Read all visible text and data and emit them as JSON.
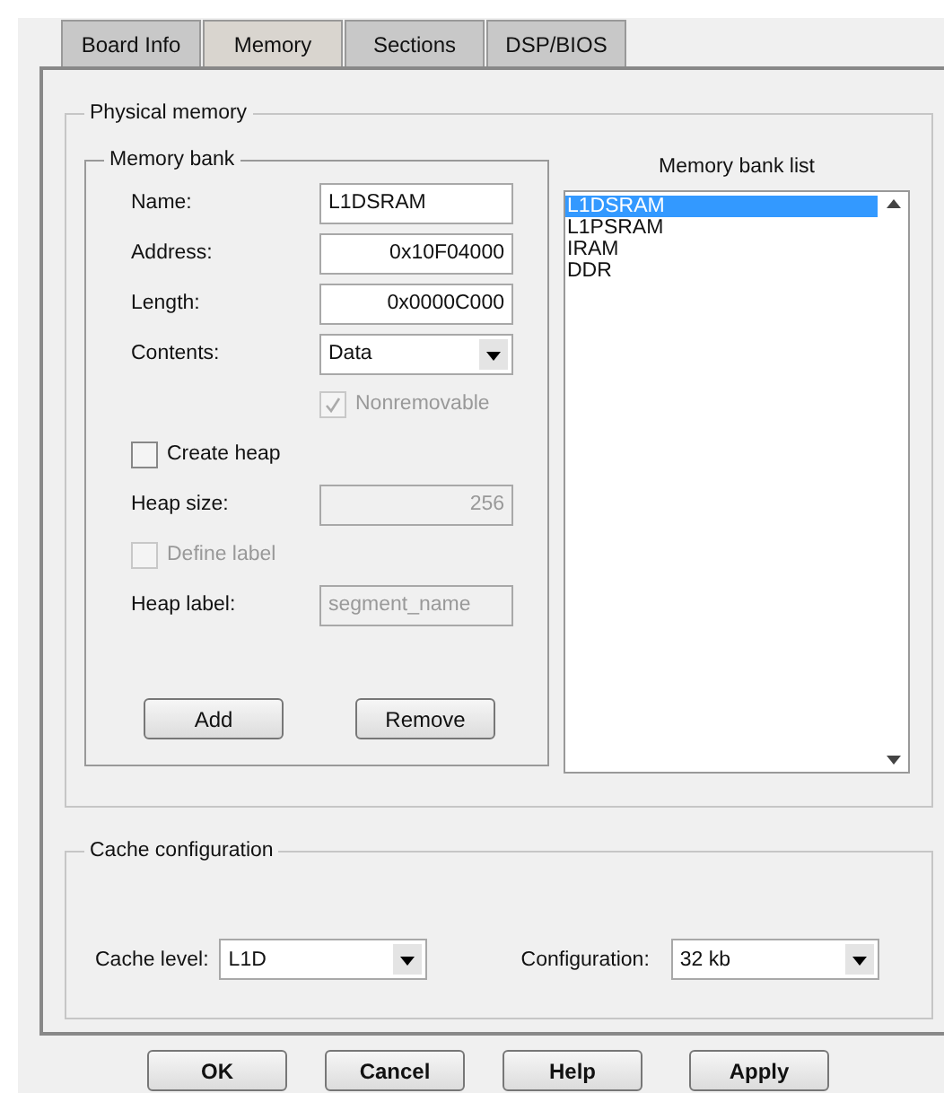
{
  "tabs": [
    {
      "label": "Board Info",
      "selected": false
    },
    {
      "label": "Memory",
      "selected": true
    },
    {
      "label": "Sections",
      "selected": false
    },
    {
      "label": "DSP/BIOS",
      "selected": false
    }
  ],
  "physical_memory": {
    "title": "Physical memory",
    "memory_bank": {
      "title": "Memory bank",
      "fields": [
        {
          "label": "Name:",
          "value": "L1DSRAM",
          "kind": "text"
        },
        {
          "label": "Address:",
          "value": "0x10F04000",
          "kind": "number"
        },
        {
          "label": "Length:",
          "value": "0x0000C000",
          "kind": "number"
        },
        {
          "label": "Contents:",
          "value": "Data",
          "kind": "select"
        }
      ],
      "nonremovable": {
        "label": "Nonremovable",
        "checked": true,
        "disabled": true
      },
      "create_heap": {
        "label": "Create heap",
        "checked": false,
        "disabled": false
      },
      "heap_size": {
        "label": "Heap size:",
        "value": "256",
        "disabled": true
      },
      "define_label": {
        "label": "Define label",
        "checked": false,
        "disabled": true
      },
      "heap_label": {
        "label": "Heap label:",
        "value": "segment_name",
        "disabled": true
      },
      "buttons": [
        "Add",
        "Remove"
      ]
    },
    "bank_list": {
      "title": "Memory bank list",
      "items": [
        {
          "label": "L1DSRAM",
          "selected": true
        },
        {
          "label": "L1PSRAM",
          "selected": false
        },
        {
          "label": "IRAM",
          "selected": false
        },
        {
          "label": "DDR",
          "selected": false
        }
      ]
    }
  },
  "cache_configuration": {
    "title": "Cache configuration",
    "cache_level": {
      "label": "Cache level:",
      "value": "L1D"
    },
    "configuration": {
      "label": "Configuration:",
      "value": "32 kb"
    }
  },
  "buttons": [
    "OK",
    "Cancel",
    "Help",
    "Apply"
  ]
}
